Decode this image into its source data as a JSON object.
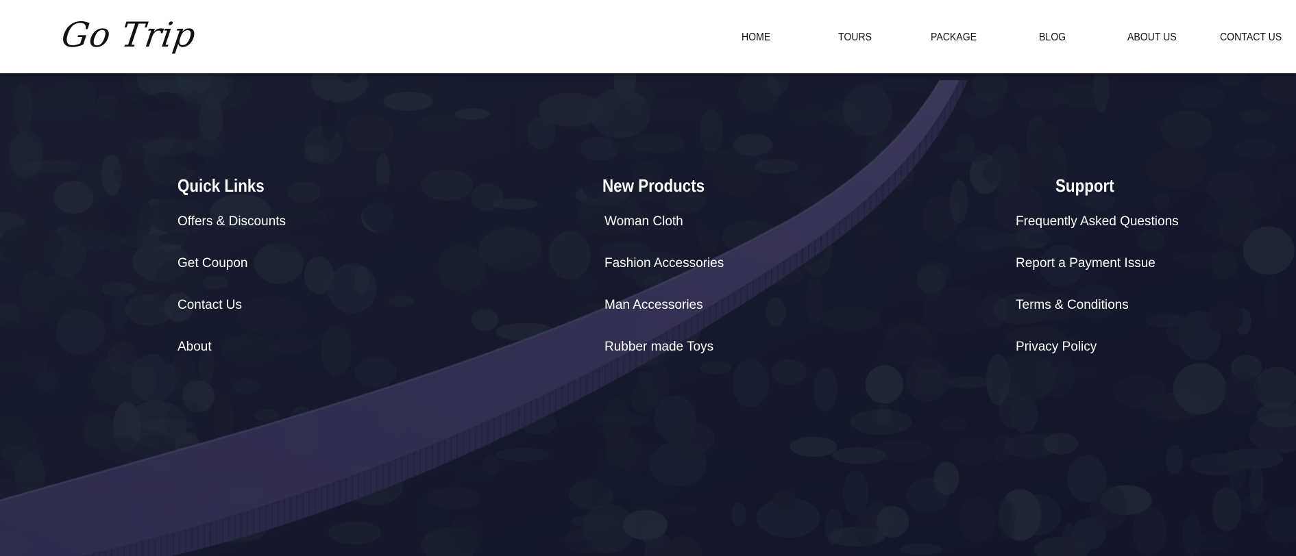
{
  "site": {
    "logo": "Go Trip"
  },
  "nav": {
    "items": [
      {
        "label": "HOME"
      },
      {
        "label": "TOURS"
      },
      {
        "label": "PACKAGE"
      },
      {
        "label": "BLOG"
      },
      {
        "label": "ABOUT US"
      },
      {
        "label": "CONTACT US"
      }
    ]
  },
  "footer": {
    "columns": [
      {
        "heading": "Quick Links",
        "links": [
          "Offers & Discounts",
          "Get Coupon",
          "Contact Us",
          "About"
        ]
      },
      {
        "heading": "New Products",
        "links": [
          "Woman Cloth",
          "Fashion Accessories",
          "Man Accessories",
          "Rubber made Toys"
        ]
      },
      {
        "heading": "Support",
        "links": [
          "Frequently Asked Questions",
          "Report a Payment Issue",
          "Terms & Conditions",
          "Privacy Policy"
        ]
      }
    ]
  },
  "colors": {
    "header_bg": "#ffffff",
    "header_text": "#111111",
    "footer_overlay": "#100e30",
    "footer_text": "#ffffff"
  }
}
